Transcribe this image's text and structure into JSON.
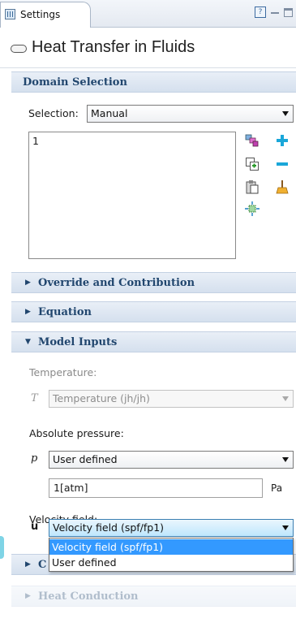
{
  "tab": {
    "label": "Settings"
  },
  "title": "Heat Transfer in Fluids",
  "domain_selection": {
    "header": "Domain Selection",
    "selection_label": "Selection:",
    "selection_value": "Manual",
    "list_entries": [
      "1"
    ]
  },
  "sections": {
    "override": "Override and Contribution",
    "equation": "Equation",
    "model_inputs": "Model Inputs",
    "partial_hidden": "C",
    "heat_conduction": "Heat Conduction"
  },
  "model_inputs": {
    "temperature_label": "Temperature:",
    "temperature_symbol": "T",
    "temperature_value": "Temperature (jh/jh)",
    "pressure_label": "Absolute pressure:",
    "pressure_symbol": "p",
    "pressure_value": "User defined",
    "pressure_input": "1[atm]",
    "pressure_unit": "Pa",
    "velocity_label": "Velocity field:",
    "velocity_symbol": "u",
    "velocity_value": "Velocity field (spf/fp1)",
    "velocity_options": [
      "Velocity field (spf/fp1)",
      "User defined"
    ],
    "velocity_selected_index": 0
  },
  "colors": {
    "section_text": "#21466e",
    "selection_highlight": "#3399ff"
  }
}
